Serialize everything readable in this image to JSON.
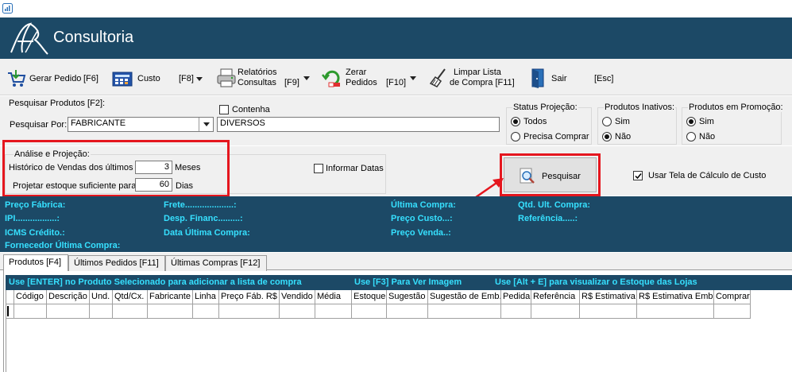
{
  "app": {
    "title": "Consultoria"
  },
  "toolbar": {
    "gerar_pedido": "Gerar Pedido",
    "gerar_pedido_key": "[F6]",
    "custo": "Custo",
    "custo_key": "[F8]",
    "relatorios_line1": "Relatórios",
    "relatorios_line2": "Consultas",
    "relatorios_key": "[F9]",
    "zerar_line1": "Zerar",
    "zerar_line2": "Pedidos",
    "zerar_key": "[F10]",
    "limpar_line1": "Limpar Lista",
    "limpar_line2": "de Compra [F11]",
    "sair": "Sair",
    "sair_key": "[Esc]"
  },
  "search": {
    "section_label": "Pesquisar Produtos [F2]:",
    "search_by_label": "Pesquisar Por:",
    "search_by_value": "FABRICANTE",
    "contenha_label": "Contenha",
    "query_value": "DIVERSOS"
  },
  "status_projecao": {
    "title": "Status Projeção:",
    "options": [
      "Todos",
      "Precisa Comprar"
    ],
    "selected": "Todos"
  },
  "produtos_inativos": {
    "title": "Produtos Inativos:",
    "options": [
      "Sim",
      "Não"
    ],
    "selected": "Não"
  },
  "produtos_promocao": {
    "title": "Produtos em Promoção:",
    "options": [
      "Sim",
      "Não"
    ],
    "selected": "Sim"
  },
  "analysis": {
    "title": "Análise e Projeção:",
    "historico_label": "Histórico de Vendas dos últimos",
    "historico_value": "3",
    "historico_unit": "Meses",
    "projetar_label": "Projetar estoque suficiente para",
    "projetar_value": "60",
    "projetar_unit": "Dias",
    "informar_datas_label": "Informar Datas",
    "pesquisar_button": "Pesquisar",
    "usar_tela_label": "Usar Tela de Cálculo de Custo",
    "usar_tela_checked": true
  },
  "info_panel": {
    "preco_fabrica": "Preço Fábrica:",
    "ipi": "IPI.................:",
    "icms": "ICMS Crédito.:",
    "fornecedor": "Fornecedor Última Compra:",
    "frete": "Frete....................:",
    "desp_financ": "Desp. Financ.........:",
    "data_ultima": "Data Última Compra:",
    "ultima_compra": "Última Compra:",
    "preco_custo": "Preço Custo...:",
    "preco_venda": "Preço Venda..:",
    "qtd_ult": "Qtd. Ult. Compra:",
    "referencia": "Referência.....:"
  },
  "tabs": [
    "Produtos  [F4]",
    "Últimos Pedidos [F11]",
    "Últimas Compras [F12]"
  ],
  "hints": {
    "enter": "Use [ENTER] no Produto Selecionado para adicionar a lista de compra",
    "f3": "Use [F3] Para Ver Imagem",
    "alt_e": "Use [Alt + E] para visualizar o Estoque das Lojas"
  },
  "grid": {
    "columns": [
      "Código",
      "Descrição",
      "Und.",
      "Qtd/Cx.",
      "Fabricante",
      "Linha",
      "Preço Fáb. R$",
      "Vendido",
      "Média",
      "Estoque",
      "Sugestão",
      "Sugestão de Emb.",
      "Pedida",
      "Referência",
      "R$ Estimativa",
      "R$ Estimativa Emb.",
      "Comprar"
    ]
  },
  "colors": {
    "banner": "#1c4966",
    "info_text": "#36e0ff",
    "highlight": "#e5161e"
  }
}
